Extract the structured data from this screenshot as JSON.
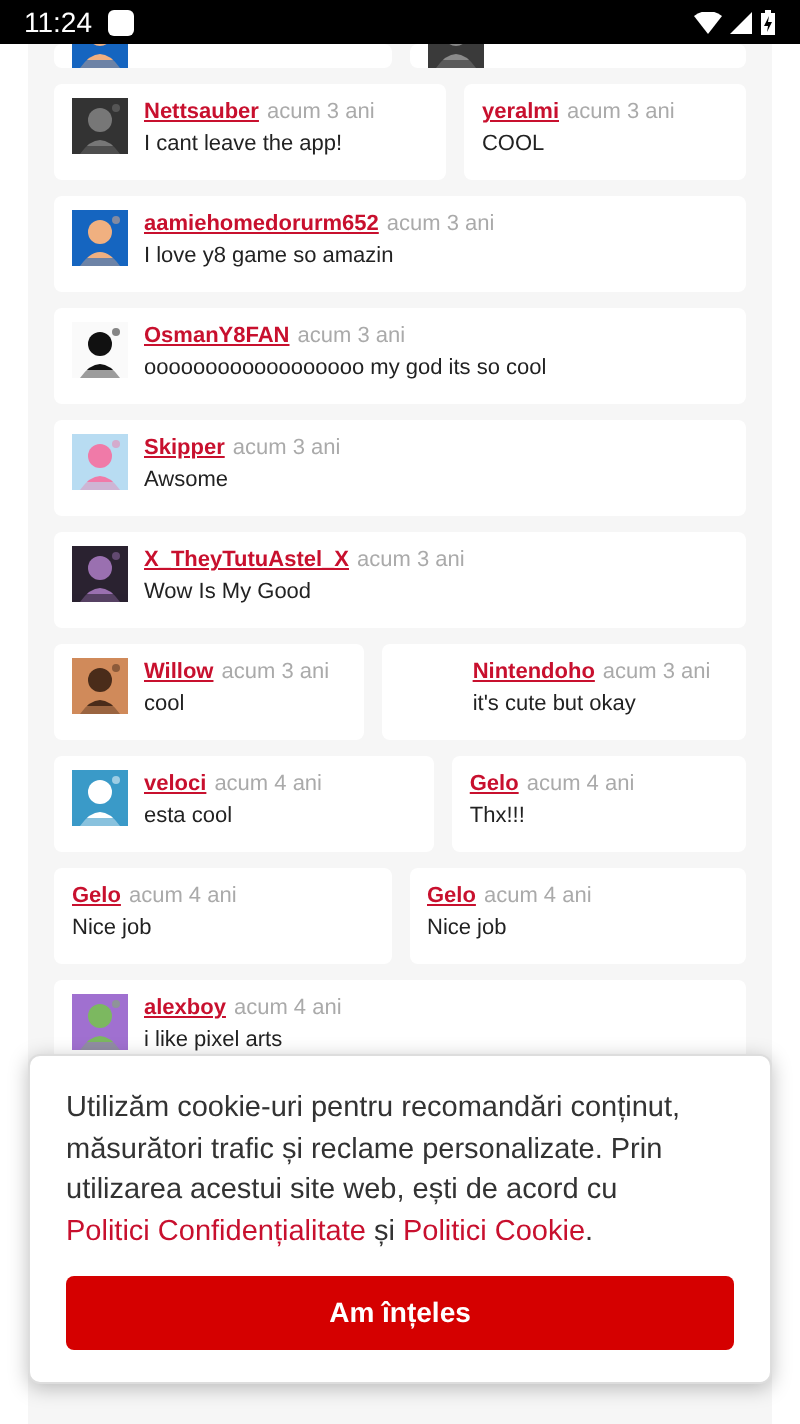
{
  "status_bar": {
    "time": "11:24"
  },
  "cut_cards": [
    {
      "avatar": true
    },
    {
      "avatar": true
    }
  ],
  "rows": [
    {
      "comments": [
        {
          "user": "Nettsauber",
          "time": "acum 3 ani",
          "text": "I cant leave the app!",
          "avatar": true
        },
        {
          "user": "yeralmi",
          "time": "acum 3 ani",
          "text": "COOL",
          "avatar": false
        }
      ]
    },
    {
      "comments": [
        {
          "user": "aamiehomedorurm652",
          "time": "acum 3 ani",
          "text": "I love y8 game so amazin",
          "avatar": true
        }
      ]
    },
    {
      "comments": [
        {
          "user": "OsmanY8FAN",
          "time": "acum 3 ani",
          "text": "oooooooooooooooooo my god its so cool",
          "avatar": true
        }
      ]
    },
    {
      "comments": [
        {
          "user": "Skipper",
          "time": "acum 3 ani",
          "text": "Awsome",
          "avatar": true
        }
      ]
    },
    {
      "comments": [
        {
          "user": "X_TheyTutuAstel_X",
          "time": "acum 3 ani",
          "text": "Wow Is My Good",
          "avatar": true
        }
      ]
    },
    {
      "comments": [
        {
          "user": "Willow",
          "time": "acum 3 ani",
          "text": "cool",
          "avatar": true
        },
        {
          "user": "Nintendoho",
          "time": "acum 3 ani",
          "text": "it's cute but okay",
          "avatar": false,
          "indented": true
        }
      ]
    },
    {
      "comments": [
        {
          "user": "veloci",
          "time": "acum 4 ani",
          "text": "esta cool",
          "avatar": true
        },
        {
          "user": "Gelo",
          "time": "acum 4 ani",
          "text": "Thx!!!",
          "avatar": false
        }
      ]
    },
    {
      "comments": [
        {
          "user": "Gelo",
          "time": "acum 4 ani",
          "text": "Nice job",
          "avatar": false
        },
        {
          "user": "Gelo",
          "time": "acum 4 ani",
          "text": "Nice job",
          "avatar": false
        }
      ]
    },
    {
      "comments": [
        {
          "user": "alexboy",
          "time": "acum 4 ani",
          "text": "i like pixel arts",
          "avatar": true
        }
      ]
    }
  ],
  "cookie_notice": {
    "text": "Utilizăm cookie-uri pentru recomandări conținut, măsurători trafic și reclame personalizate. Prin utilizarea acestui site web, ești de acord cu",
    "link_1": "Politici Confidențialitate",
    "conjunction": "și",
    "link_2": "Politici Cookie",
    "end": ".",
    "button": "Am înțeles"
  }
}
